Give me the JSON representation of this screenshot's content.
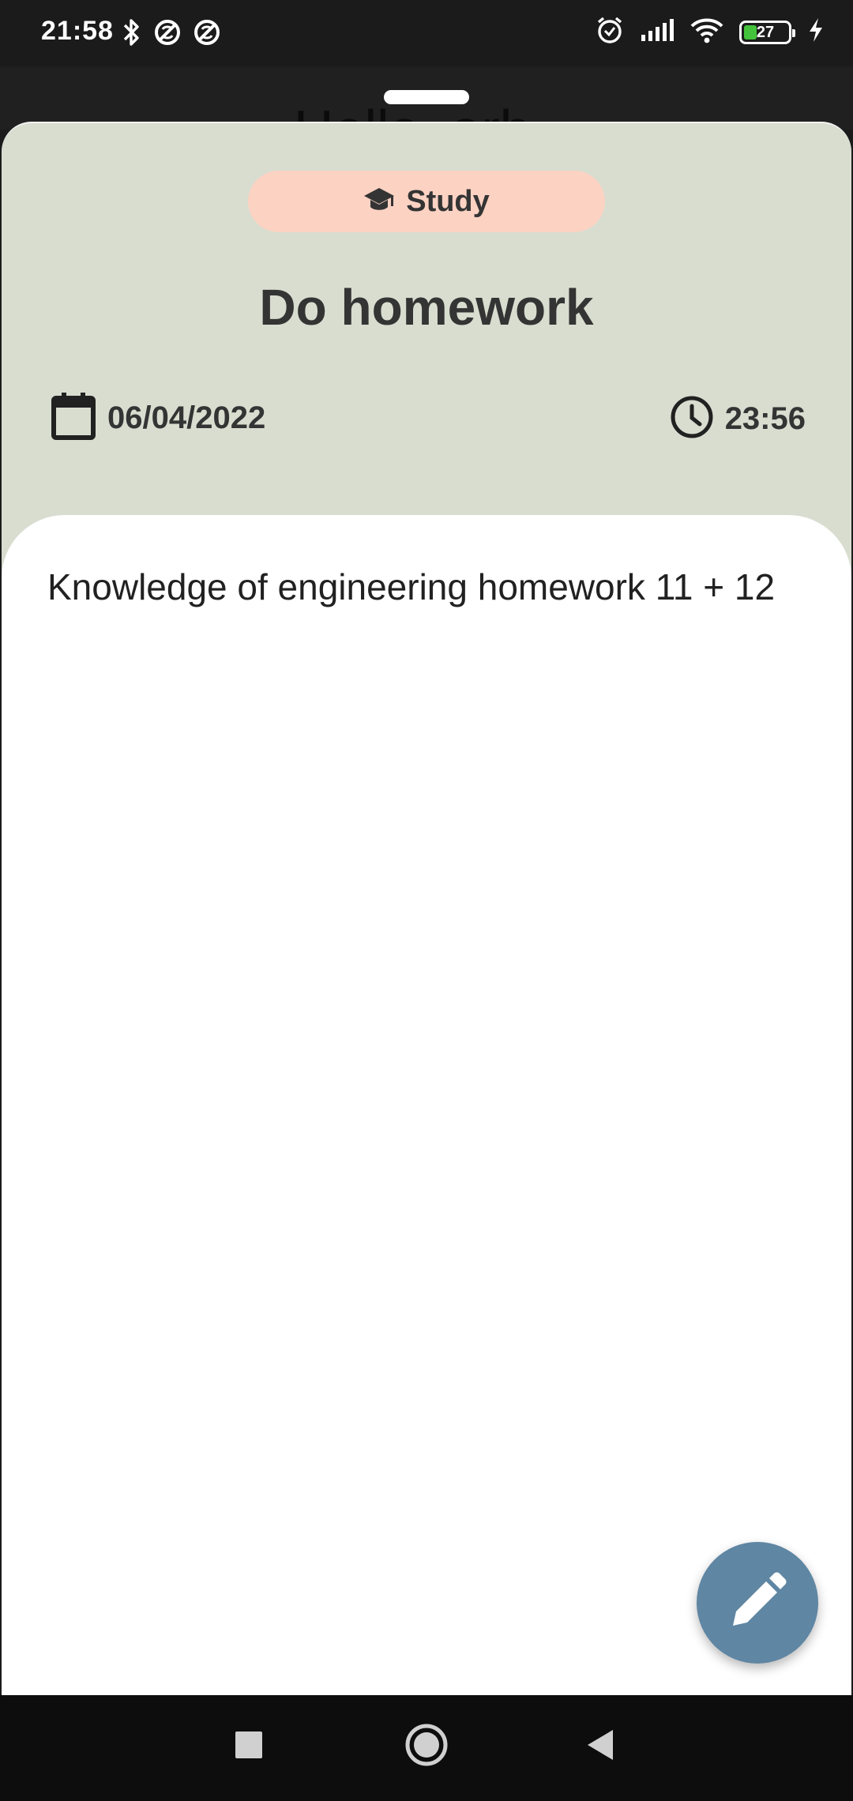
{
  "status_bar": {
    "time": "21:58",
    "battery_level": "27",
    "icons": [
      "bluetooth-icon",
      "sync-off-icon",
      "sync-off-icon",
      "alarm-icon",
      "cell-signal-icon",
      "wifi-icon",
      "battery-icon",
      "charging-icon"
    ]
  },
  "background_app": {
    "partial_text": "Hello, arh"
  },
  "task": {
    "category": {
      "label": "Study",
      "icon": "graduation-cap-icon",
      "chip_color": "#fcd2c3"
    },
    "title": "Do homework",
    "date": "06/04/2022",
    "time": "23:56",
    "description": "Knowledge of engineering homework 11 + 12"
  },
  "fab": {
    "icon": "edit-pencil-icon",
    "color": "#5f86a3"
  },
  "nav_bar": {
    "buttons": [
      "recents-button",
      "home-button",
      "back-button"
    ]
  },
  "colors": {
    "sheet_background": "#d8ddd0",
    "card_background": "#ffffff",
    "text_primary": "#343434"
  }
}
